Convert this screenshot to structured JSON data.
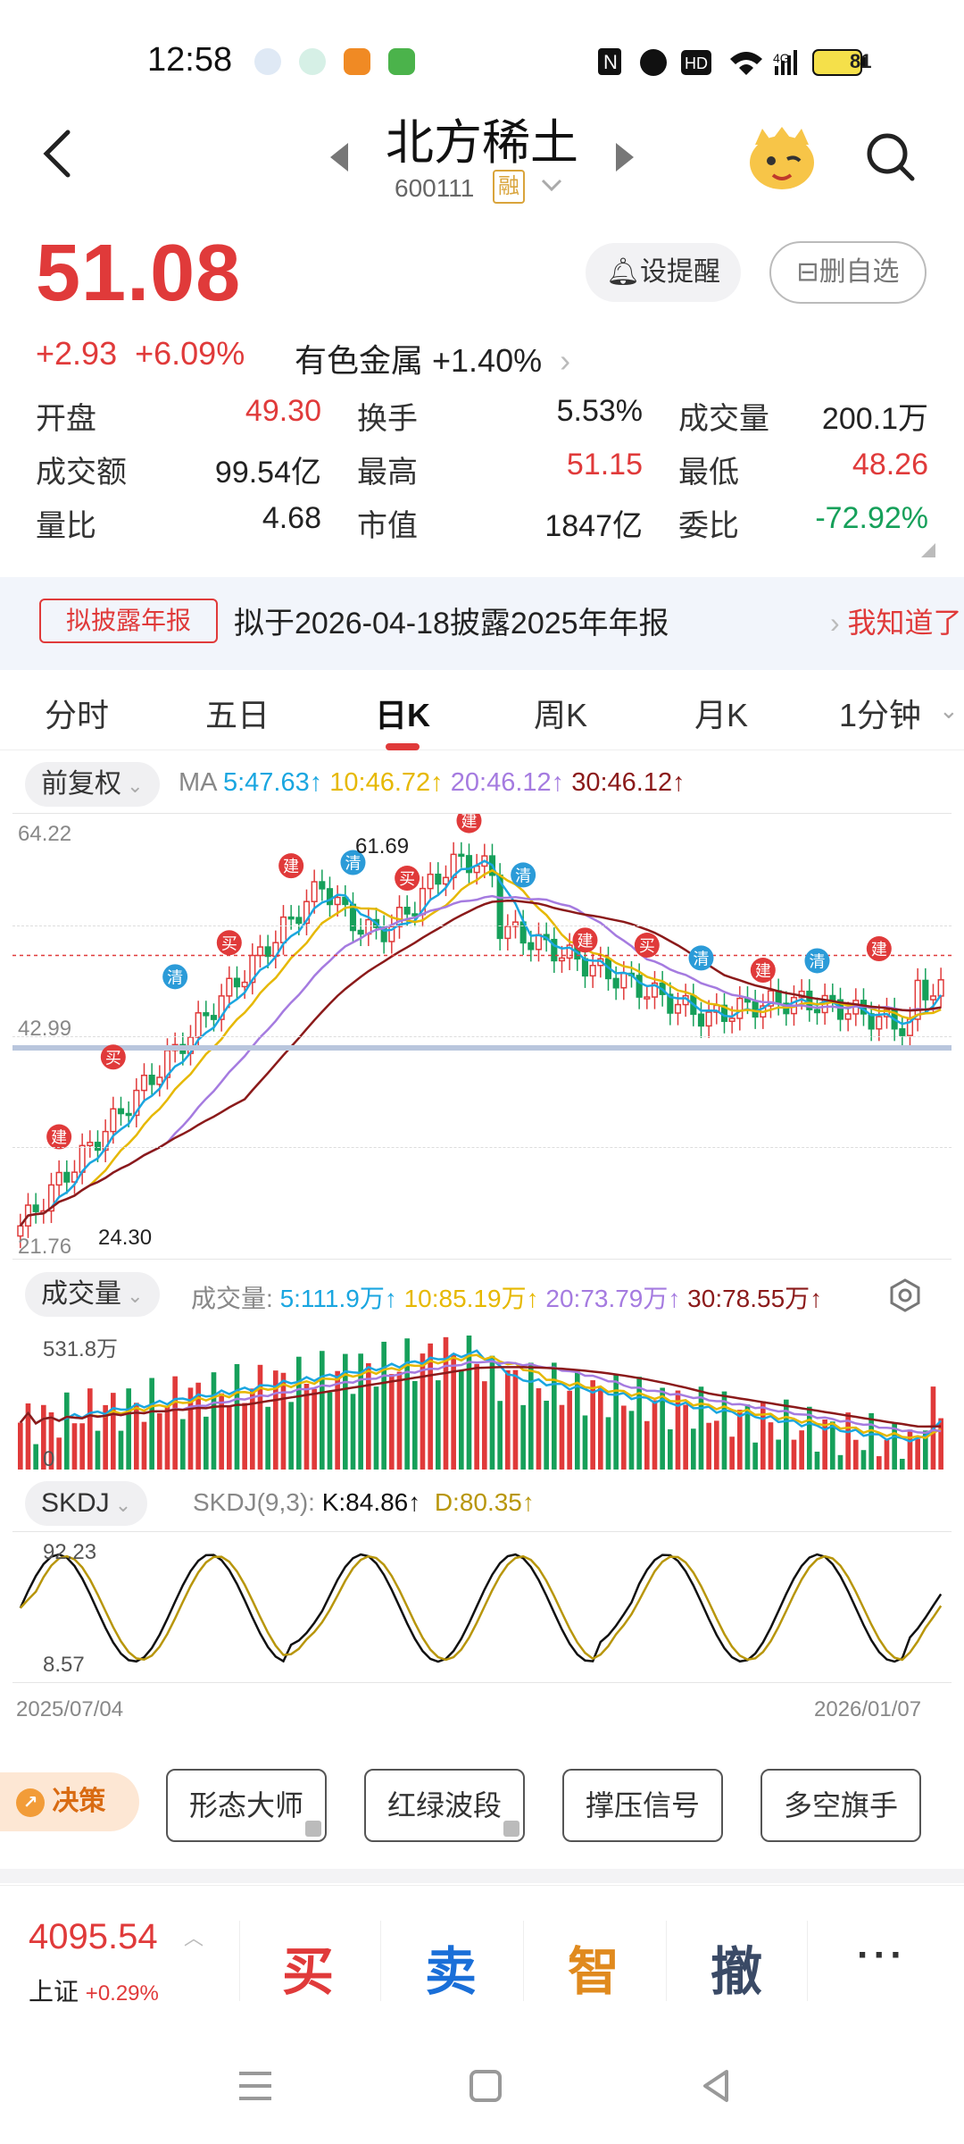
{
  "status": {
    "time": "12:58",
    "battery": "81"
  },
  "header": {
    "title": "北方稀土",
    "code": "600111",
    "margin_badge": "融"
  },
  "quote": {
    "price": "51.08",
    "change": "+2.93",
    "change_pct": "+6.09%",
    "sector": "有色金属 +1.40%",
    "remind_label": "设提醒",
    "delete_label": "删自选",
    "stats": [
      [
        [
          "开盘",
          "49.30",
          "red"
        ],
        [
          "换手",
          "5.53%",
          "dark"
        ],
        [
          "成交量",
          "200.1万",
          "dark"
        ]
      ],
      [
        [
          "成交额",
          "99.54亿",
          "dark"
        ],
        [
          "最高",
          "51.15",
          "red"
        ],
        [
          "最低",
          "48.26",
          "red"
        ]
      ],
      [
        [
          "量比",
          "4.68",
          "dark"
        ],
        [
          "市值",
          "1847亿",
          "dark"
        ],
        [
          "委比",
          "-72.92%",
          "green"
        ]
      ]
    ]
  },
  "banner": {
    "tag": "拟披露年报",
    "text": "拟于2026-04-18披露2025年年报",
    "action": "我知道了"
  },
  "tabs": [
    "分时",
    "五日",
    "日K",
    "周K",
    "月K",
    "1分钟"
  ],
  "kline": {
    "adjust": "前复权",
    "ma_label": "MA",
    "ma": [
      {
        "text": "5:47.63↑",
        "color": "#1aa6e0"
      },
      {
        "text": "10:46.72↑",
        "color": "#e6b800"
      },
      {
        "text": "20:46.12↑",
        "color": "#a57be0"
      },
      {
        "text": "30:46.12↑",
        "color": "#8b1a1a"
      }
    ],
    "y_top": "64.22",
    "y_mid": "42.99",
    "y_bottom": "21.76",
    "high_mark": "61.69",
    "low_mark": "24.30"
  },
  "volume": {
    "label": "成交量",
    "legend_label": "成交量:",
    "ma": [
      {
        "text": "5:111.9万↑",
        "color": "#1aa6e0"
      },
      {
        "text": "10:85.19万↑",
        "color": "#e6b800"
      },
      {
        "text": "20:73.79万↑",
        "color": "#a57be0"
      },
      {
        "text": "30:78.55万↑",
        "color": "#8b1a1a"
      }
    ],
    "y_top": "531.8万",
    "y_bottom": "0"
  },
  "skdj": {
    "label": "SKDJ",
    "params": "SKDJ(9,3):",
    "k": "K:84.86↑",
    "d": "D:80.35↑",
    "y_top": "92.23",
    "y_bottom": "8.57",
    "date_start": "2025/07/04",
    "date_end": "2026/01/07"
  },
  "tools": {
    "decision": "决策",
    "buttons": [
      "形态大师",
      "红绿波段",
      "撑压信号",
      "多空旗手"
    ]
  },
  "bottom": {
    "index_value": "4095.54",
    "index_name": "上证",
    "index_change": "+0.29%",
    "actions": [
      {
        "label": "买",
        "color": "#e03a3a"
      },
      {
        "label": "卖",
        "color": "#1a6fd8"
      },
      {
        "label": "智",
        "color": "#e08a1e"
      },
      {
        "label": "撤",
        "color": "#3a4a66"
      }
    ],
    "more": "···"
  }
}
